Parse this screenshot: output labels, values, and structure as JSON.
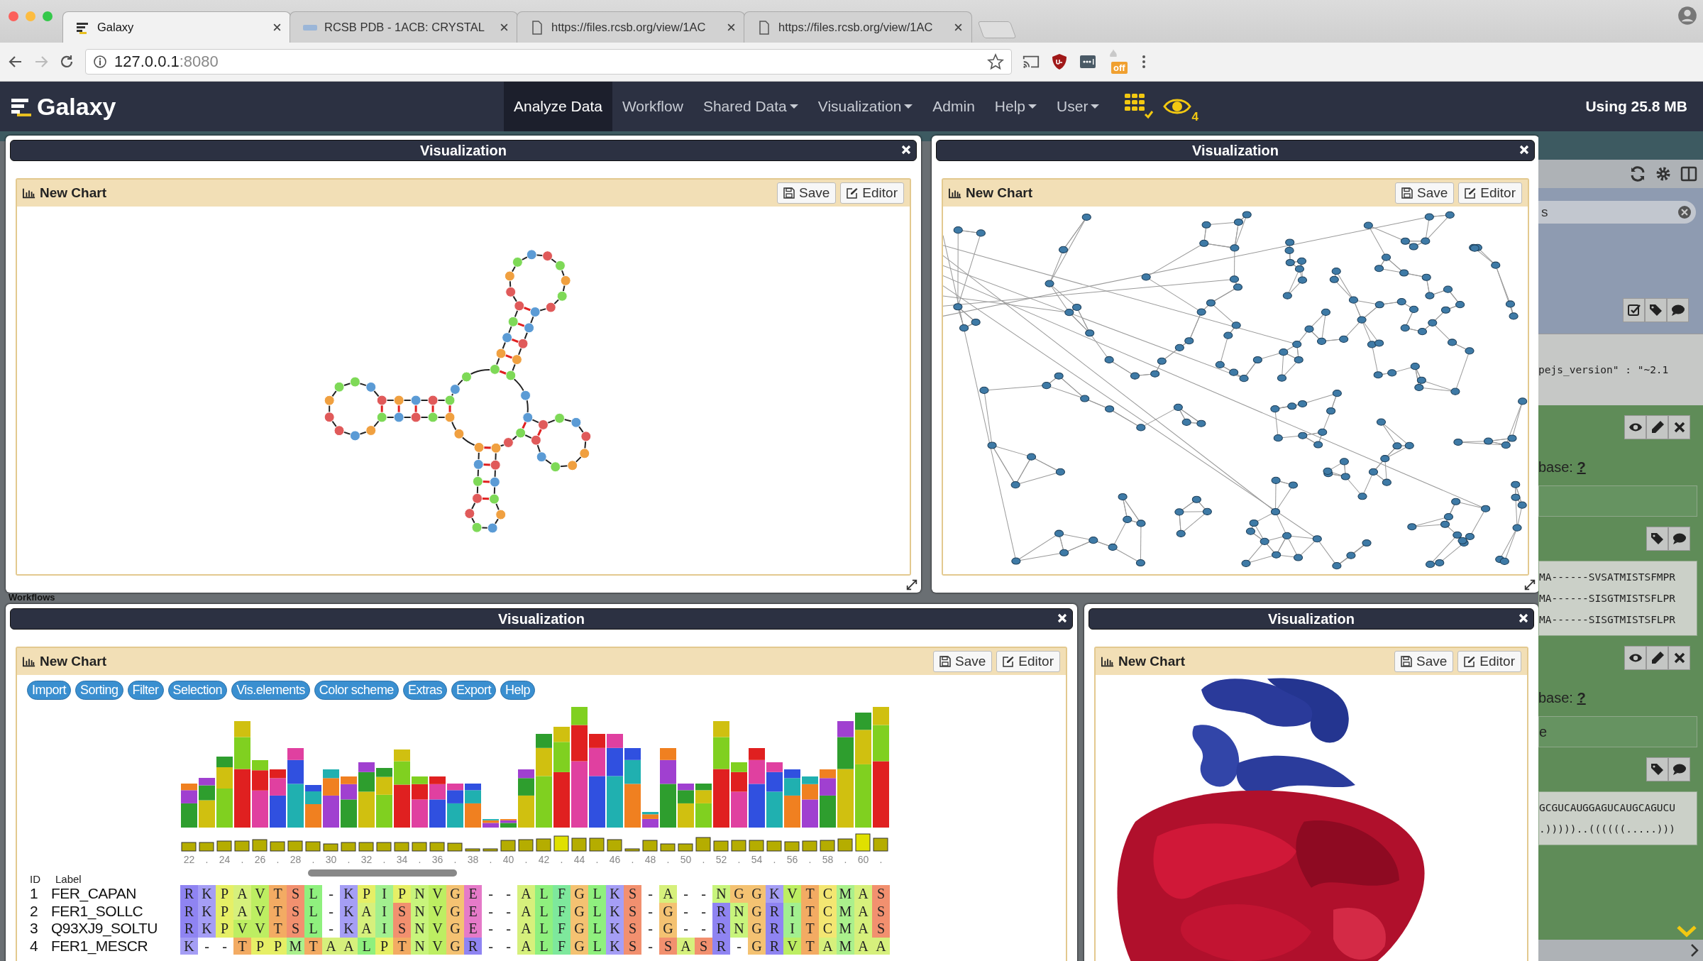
{
  "browser": {
    "tabs": [
      {
        "title": "Galaxy",
        "selected": true,
        "kind": "galaxy"
      },
      {
        "title": "RCSB PDB - 1ACB: CRYSTAL",
        "selected": false,
        "kind": "pdb"
      },
      {
        "title": "https://files.rcsb.org/view/1AC",
        "selected": false,
        "kind": "doc"
      },
      {
        "title": "https://files.rcsb.org/view/1AC",
        "selected": false,
        "kind": "doc"
      }
    ],
    "address": {
      "host": "127.0.0.1",
      "port": ":8080"
    },
    "extension_badge": "off"
  },
  "masthead": {
    "brand": "Galaxy",
    "nav": [
      {
        "label": "Analyze Data",
        "selected": true,
        "dropdown": false
      },
      {
        "label": "Workflow",
        "selected": false,
        "dropdown": false
      },
      {
        "label": "Shared Data",
        "selected": false,
        "dropdown": true
      },
      {
        "label": "Visualization",
        "selected": false,
        "dropdown": true
      },
      {
        "label": "Admin",
        "selected": false,
        "dropdown": false
      },
      {
        "label": "Help",
        "selected": false,
        "dropdown": true
      },
      {
        "label": "User",
        "selected": false,
        "dropdown": true
      }
    ],
    "visualizations_count": "4",
    "usage": "Using 25.8 MB"
  },
  "background": {
    "label": "Workflows"
  },
  "windows": [
    {
      "title": "Visualization",
      "chart_title": "New Chart",
      "kind": "rna",
      "resize_handle": true,
      "buttons": [
        {
          "label": "Save",
          "kind": "save"
        },
        {
          "label": "Editor",
          "kind": "edit"
        }
      ]
    },
    {
      "title": "Visualization",
      "chart_title": "New Chart",
      "kind": "network",
      "resize_handle": true,
      "buttons": [
        {
          "label": "Save",
          "kind": "save"
        },
        {
          "label": "Editor",
          "kind": "edit"
        }
      ]
    },
    {
      "title": "Visualization",
      "chart_title": "New Chart",
      "kind": "alignment",
      "buttons": [
        {
          "label": "Save",
          "kind": "save"
        },
        {
          "label": "Editor",
          "kind": "edit"
        }
      ]
    },
    {
      "title": "Visualization",
      "chart_title": "New Chart",
      "kind": "structure",
      "buttons": [
        {
          "label": "Save",
          "kind": "save"
        },
        {
          "label": "Editor",
          "kind": "edit"
        }
      ]
    }
  ],
  "alignment": {
    "toolbar": [
      "Import",
      "Sorting",
      "Filter",
      "Selection",
      "Vis.elements",
      "Color scheme",
      "Extras",
      "Export",
      "Help"
    ],
    "positions": [
      "22",
      ".",
      "24",
      ".",
      "26",
      ".",
      "28",
      ".",
      "30",
      ".",
      "32",
      ".",
      "34",
      ".",
      "36",
      ".",
      "38",
      ".",
      "40",
      ".",
      "42",
      ".",
      "44",
      ".",
      "46",
      ".",
      "48",
      ".",
      "50",
      ".",
      "52",
      ".",
      "54",
      ".",
      "56",
      ".",
      "58",
      ".",
      "60",
      "."
    ],
    "id_header": "ID",
    "label_header": "Label",
    "rows": [
      {
        "id": "1",
        "label": "FER_CAPAN",
        "residues": [
          "R",
          "K",
          "P",
          "A",
          "V",
          "T",
          "S",
          "L",
          "-",
          "K",
          "P",
          "I",
          "P",
          "N",
          "V",
          "G",
          "E",
          "-",
          "-",
          "A",
          "L",
          "F",
          "G",
          "L",
          "K",
          "S",
          "-",
          "A",
          "-",
          "-",
          "N",
          "G",
          "G",
          "K",
          "V",
          "T",
          "C",
          "M",
          "A",
          "S"
        ]
      },
      {
        "id": "2",
        "label": "FER1_SOLLC",
        "residues": [
          "R",
          "K",
          "P",
          "A",
          "V",
          "T",
          "S",
          "L",
          "-",
          "K",
          "A",
          "I",
          "S",
          "N",
          "V",
          "G",
          "E",
          "-",
          "-",
          "A",
          "L",
          "F",
          "G",
          "L",
          "K",
          "S",
          "-",
          "G",
          "-",
          "-",
          "R",
          "N",
          "G",
          "R",
          "I",
          "T",
          "C",
          "M",
          "A",
          "S"
        ]
      },
      {
        "id": "3",
        "label": "Q93XJ9_SOLTU",
        "residues": [
          "R",
          "K",
          "P",
          "V",
          "V",
          "T",
          "S",
          "L",
          "-",
          "K",
          "A",
          "I",
          "S",
          "N",
          "V",
          "G",
          "E",
          "-",
          "-",
          "A",
          "L",
          "F",
          "G",
          "L",
          "K",
          "S",
          "-",
          "G",
          "-",
          "-",
          "R",
          "N",
          "G",
          "R",
          "I",
          "T",
          "C",
          "M",
          "A",
          "S"
        ]
      },
      {
        "id": "4",
        "label": "FER1_MESCR",
        "residues": [
          "K",
          "-",
          "-",
          "T",
          "P",
          "P",
          "M",
          "T",
          "A",
          "A",
          "L",
          "P",
          "T",
          "N",
          "V",
          "G",
          "R",
          "-",
          "-",
          "A",
          "L",
          "F",
          "G",
          "L",
          "K",
          "S",
          "-",
          "S",
          "A",
          "S",
          "R",
          "-",
          "G",
          "R",
          "V",
          "T",
          "A",
          "M",
          "A",
          "A"
        ]
      }
    ]
  },
  "history_panel": {
    "search_value": "s",
    "json_line": "pejs_version\" : \"~2.1",
    "datasets": [
      {
        "info": "base:",
        "link": "?",
        "lines": [
          "MA------SVSATMISTSFMPR",
          "MA------SISGTMISTSFLPR",
          "MA------SISGTMISTSFLPR"
        ]
      },
      {
        "info": "base:",
        "link": "?",
        "note": "e",
        "lines": [
          "GCGUCAUGGAGUCAUGCAGUCU",
          ".)))))..((((((.....)))"
        ]
      }
    ]
  }
}
